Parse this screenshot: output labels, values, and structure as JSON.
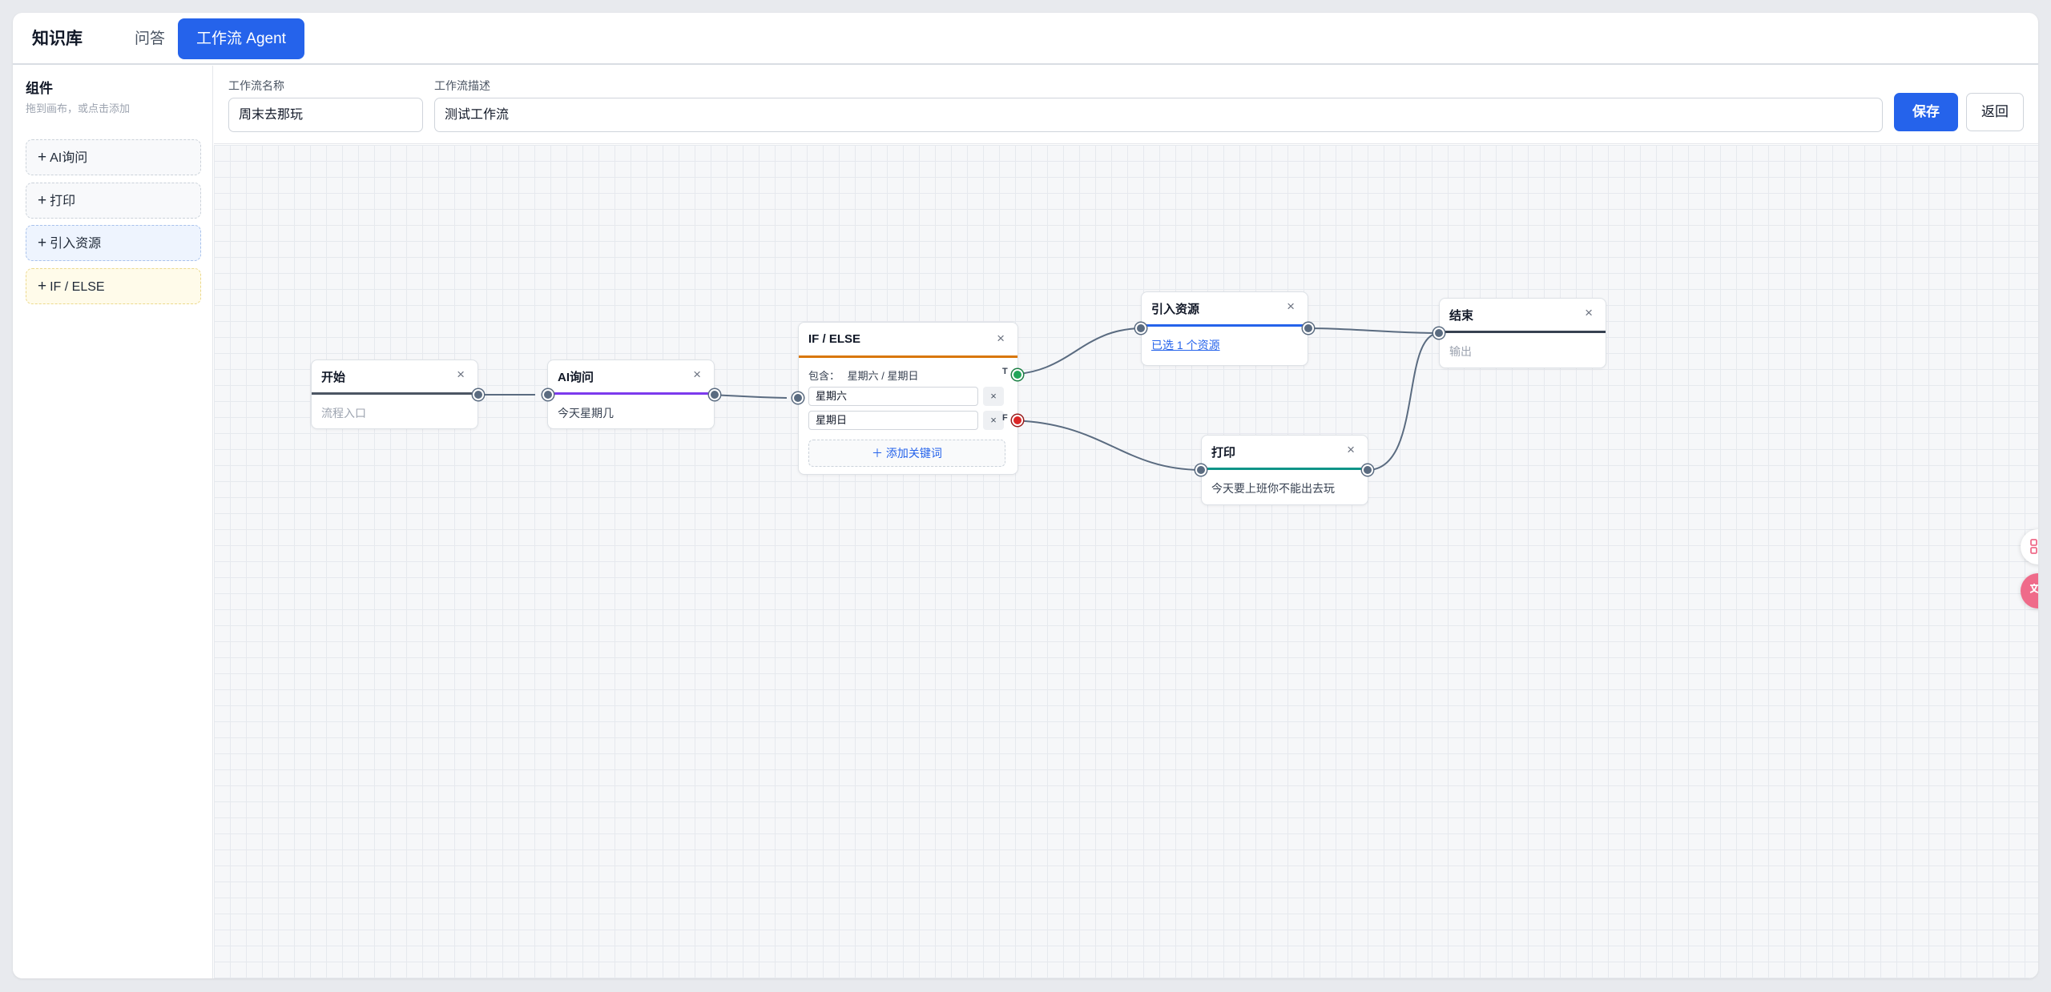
{
  "tabs": {
    "brand": "知识库",
    "qa": "问答",
    "agent": "工作流 Agent"
  },
  "sidebar": {
    "title": "组件",
    "hint": "拖到画布，或点击添加",
    "components": [
      {
        "label": "AI询问"
      },
      {
        "label": "打印"
      },
      {
        "label": "引入资源"
      },
      {
        "label": "IF / ELSE"
      }
    ]
  },
  "form": {
    "name_label": "工作流名称",
    "name_value": "周末去那玩",
    "desc_label": "工作流描述",
    "desc_value": "测试工作流",
    "save": "保存",
    "back": "返回"
  },
  "nodes": {
    "start": {
      "title": "开始",
      "body": "流程入口",
      "close": "×"
    },
    "ai": {
      "title": "AI询问",
      "body": "今天星期几",
      "close": "×"
    },
    "ifelse": {
      "title": "IF / ELSE",
      "close": "×",
      "contains_label": "包含：",
      "contains_value": "星期六 / 星期日",
      "keywords": [
        "星期六",
        "星期日"
      ],
      "remove": "×",
      "add_keyword": "＋ 添加关键词",
      "true_label": "T",
      "false_label": "F"
    },
    "resource": {
      "title": "引入资源",
      "body": "已选 1 个资源",
      "close": "×"
    },
    "print": {
      "title": "打印",
      "body": "今天要上班你不能出去玩",
      "close": "×"
    },
    "end": {
      "title": "结束",
      "body": "输出",
      "close": "×"
    }
  },
  "colors": {
    "primary": "#2563eb",
    "start_bar": "#4b5563",
    "ai_bar": "#7c3aed",
    "ifelse_bar": "#d97706",
    "resource_bar": "#2563eb",
    "print_bar": "#0d9488",
    "end_bar": "#374151",
    "edge": "#5a6b80",
    "true_port": "#22a559",
    "false_port": "#dc2626"
  },
  "floating": [
    {
      "icon": "apps-add-icon"
    },
    {
      "icon": "translate-icon"
    }
  ]
}
